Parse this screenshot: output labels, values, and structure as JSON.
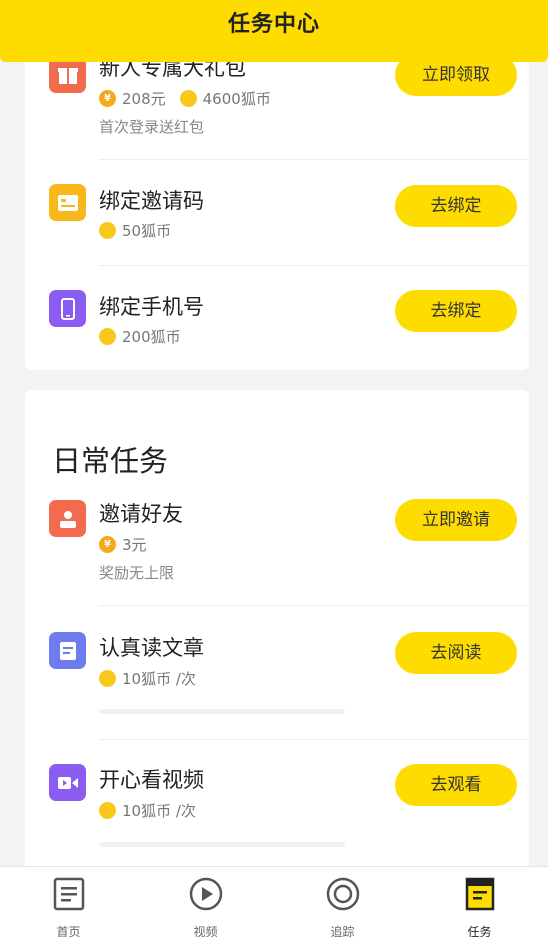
{
  "header": {
    "title": "任务中心"
  },
  "newbie": {
    "tasks": [
      {
        "title": "新人专属大礼包",
        "reward_yuan": "208元",
        "reward_coins": "4600狐币",
        "desc": "首次登录送红包",
        "button": "立即领取",
        "icon": "gift-icon",
        "icon_color": "#f26b4f"
      },
      {
        "title": "绑定邀请码",
        "reward_coins": "50狐币",
        "button": "去绑定",
        "icon": "invite-code-icon",
        "icon_color": "#f7b81a"
      },
      {
        "title": "绑定手机号",
        "reward_coins": "200狐币",
        "button": "去绑定",
        "icon": "phone-icon",
        "icon_color": "#8a5cf1"
      }
    ]
  },
  "daily": {
    "title": "日常任务",
    "tasks": [
      {
        "title": "邀请好友",
        "reward_yuan": "3元",
        "desc": "奖励无上限",
        "button": "立即邀请",
        "icon": "user-icon",
        "icon_color": "#f26b4f"
      },
      {
        "title": "认真读文章",
        "reward_coins": "10狐币 /次",
        "button": "去阅读",
        "icon": "article-icon",
        "icon_color": "#6f7cf0"
      },
      {
        "title": "开心看视频",
        "reward_coins": "10狐币 /次",
        "button": "去观看",
        "icon": "video-icon",
        "icon_color": "#8a5cf1"
      }
    ]
  },
  "tabbar": {
    "items": [
      {
        "label": "首页",
        "icon": "home-doc-icon"
      },
      {
        "label": "视频",
        "icon": "play-icon"
      },
      {
        "label": "追踪",
        "icon": "target-icon"
      },
      {
        "label": "任务",
        "icon": "task-icon"
      }
    ]
  },
  "colors": {
    "accent": "#ffdc00",
    "coin": "#f8c81c",
    "yuan": "#f6a91c"
  },
  "coin_glyph": "¥"
}
